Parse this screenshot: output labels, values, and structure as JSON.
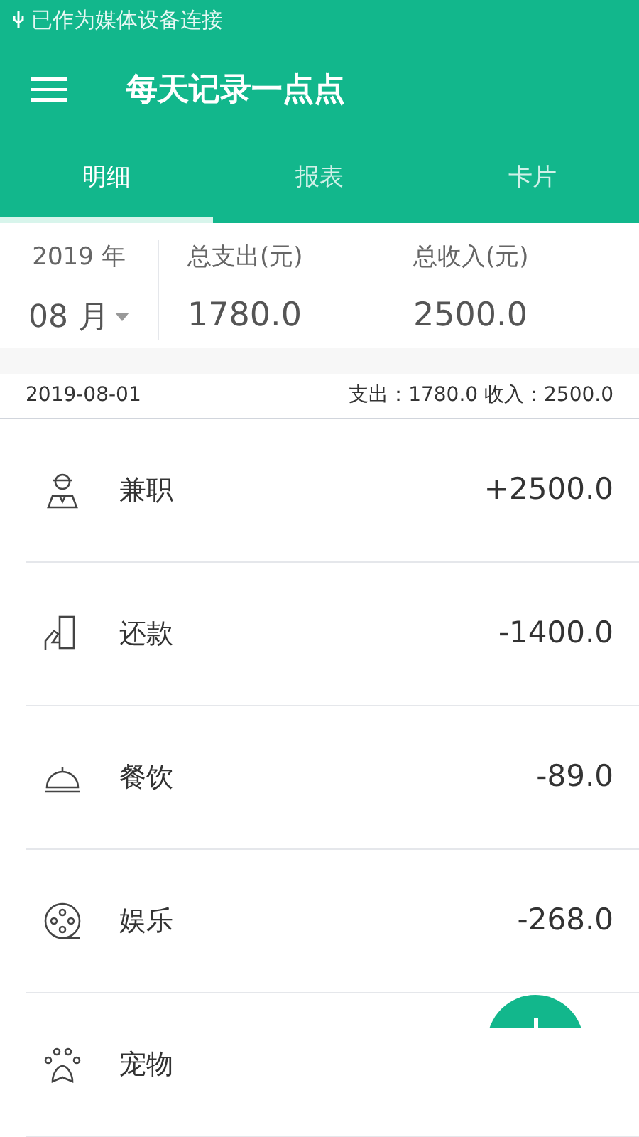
{
  "status_bar": {
    "text": "已作为媒体设备连接"
  },
  "toolbar": {
    "title": "每天记录一点点"
  },
  "tabs": [
    {
      "label": "明细",
      "selected": true
    },
    {
      "label": "报表",
      "selected": false
    },
    {
      "label": "卡片",
      "selected": false
    }
  ],
  "summary": {
    "year": "2019 年",
    "month": "08 月",
    "expense_label": "总支出(元)",
    "expense": "1780.0",
    "income_label": "总收入(元)",
    "income": "2500.0"
  },
  "day": {
    "date": "2019-08-01",
    "totals": "支出：1780.0 收入：2500.0"
  },
  "entries": [
    {
      "kind": "job",
      "name": "兼职",
      "amount": "+2500.0"
    },
    {
      "kind": "repay",
      "name": "还款",
      "amount": "-1400.0"
    },
    {
      "kind": "food",
      "name": "餐饮",
      "amount": "-89.0"
    },
    {
      "kind": "fun",
      "name": "娱乐",
      "amount": "-268.0"
    },
    {
      "kind": "pet",
      "name": "宠物"
    }
  ]
}
